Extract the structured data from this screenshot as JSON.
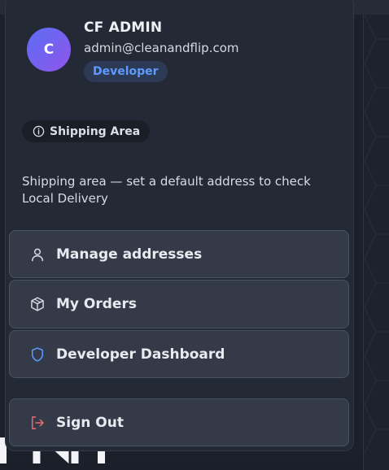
{
  "user": {
    "avatar_initial": "C",
    "name": "CF ADMIN",
    "email": "admin@cleanandflip.com",
    "role_badge": "Developer"
  },
  "shipping": {
    "chip_label": "Shipping Area",
    "chip_icon": "info-icon",
    "note": "Shipping area — set a default address to check Local Delivery"
  },
  "menu": {
    "items": [
      {
        "label": "Manage addresses",
        "icon": "user-icon"
      },
      {
        "label": "My Orders",
        "icon": "package-icon"
      },
      {
        "label": "Developer Dashboard",
        "icon": "shield-icon"
      }
    ],
    "sign_out": {
      "label": "Sign Out",
      "icon": "log-out-icon"
    }
  },
  "colors": {
    "avatar_gradient": [
      "#5b6ef5",
      "#8f55ea"
    ],
    "role_badge_text": "#5d9bff",
    "shield_icon": "#5d9bff",
    "sign_out_icon": "#f06a6a",
    "menu_background": "#242936",
    "button_background": "#343a48"
  }
}
